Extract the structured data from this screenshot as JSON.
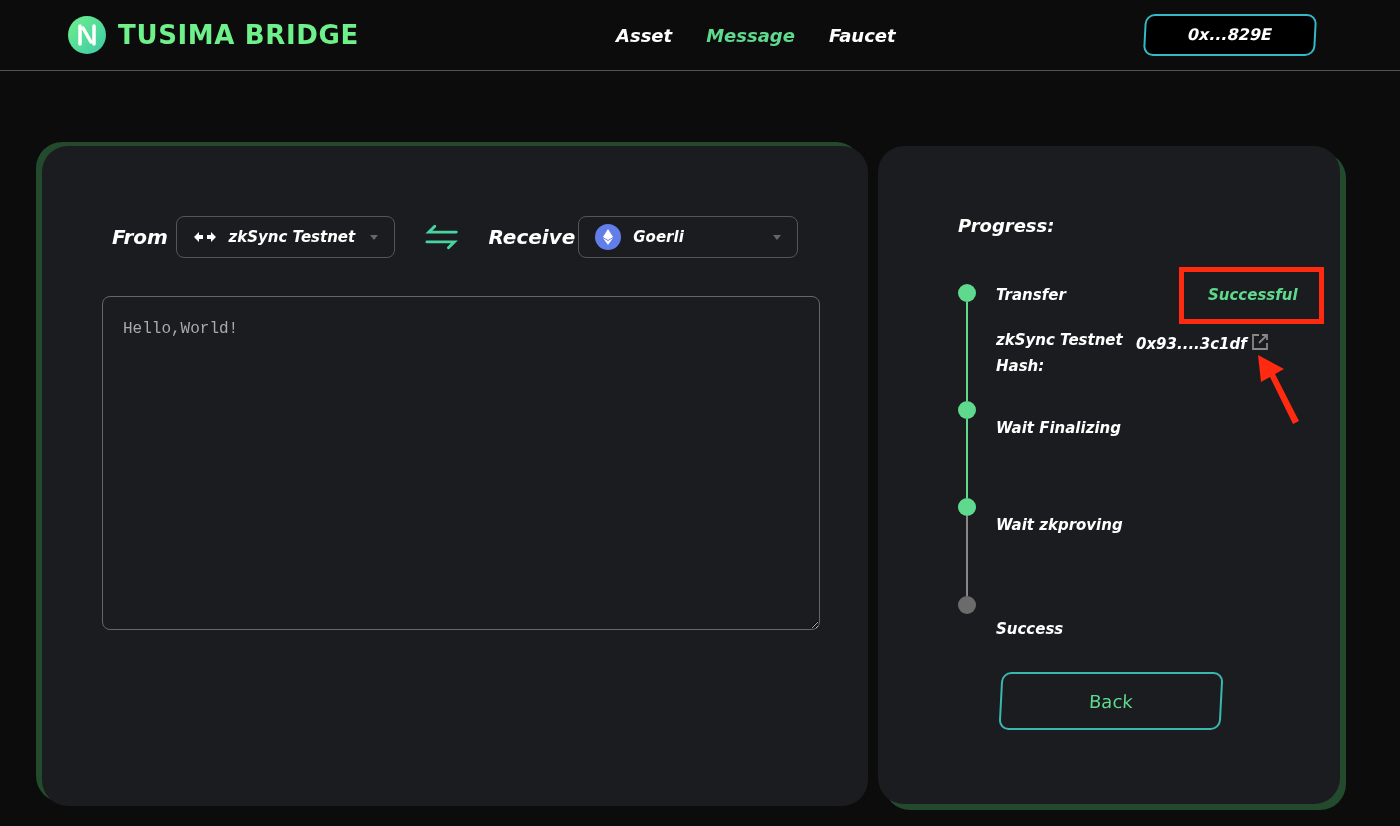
{
  "brand": {
    "name": "TUSIMA BRIDGE"
  },
  "nav": [
    {
      "label": "Asset",
      "selected": false
    },
    {
      "label": "Message",
      "selected": true
    },
    {
      "label": "Faucet",
      "selected": false
    }
  ],
  "wallet": {
    "address": "0x...829E"
  },
  "form": {
    "from_label": "From",
    "from_network": "zkSync Testnet",
    "receive_label": "Receive",
    "receive_network": "Goerli",
    "message": "Hello,World!"
  },
  "progress": {
    "title": "Progress:",
    "steps": [
      {
        "label": "Transfer",
        "done": true,
        "status": "Successful",
        "detail_label": "zkSync Testnet Hash:",
        "hash": "0x93....3c1df"
      },
      {
        "label": "Wait Finalizing",
        "done": true
      },
      {
        "label": "Wait zkproving",
        "done": true
      },
      {
        "label": "Success",
        "done": false
      }
    ]
  },
  "back_button": "Back"
}
